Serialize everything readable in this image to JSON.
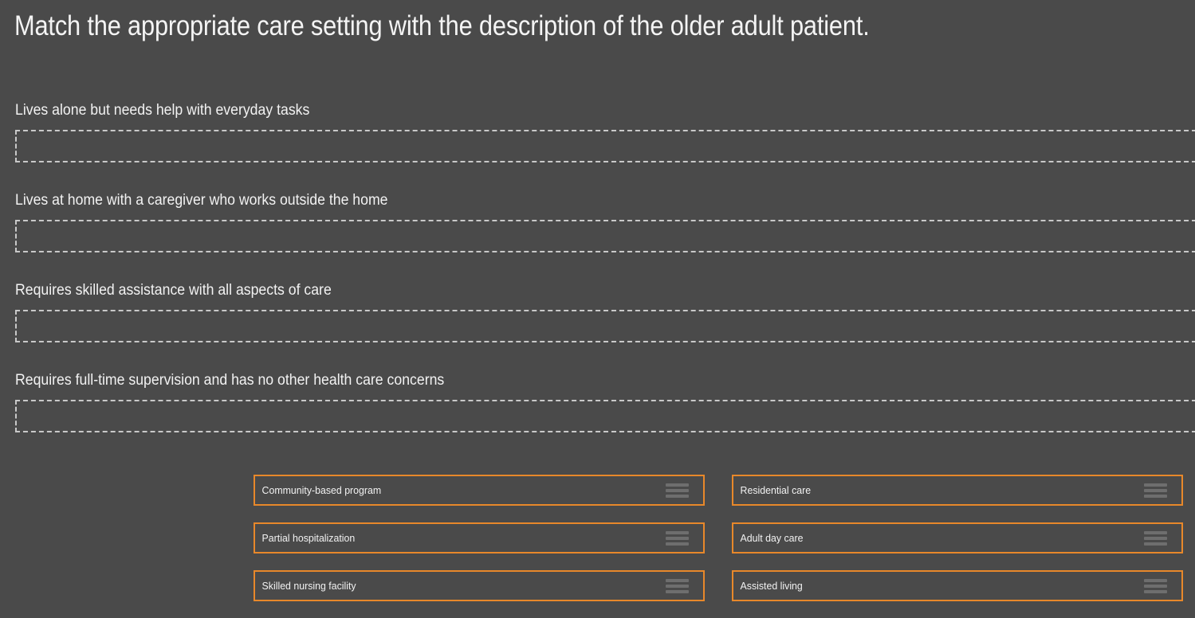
{
  "question": {
    "title": "Match the appropriate care setting with the description of the older adult patient."
  },
  "prompts": [
    {
      "label": "Lives alone but needs help with everyday tasks",
      "answer": ""
    },
    {
      "label": "Lives at home with a caregiver who works outside the home",
      "answer": ""
    },
    {
      "label": "Requires skilled assistance with all aspects of care",
      "answer": ""
    },
    {
      "label": "Requires full-time supervision and has no other health care concerns",
      "answer": ""
    }
  ],
  "options": {
    "rows": [
      {
        "left": "Community-based program",
        "right": "Residential care"
      },
      {
        "left": "Partial hospitalization",
        "right": "Adult day care"
      },
      {
        "left": "Skilled nursing facility",
        "right": "Assisted living"
      }
    ],
    "handle_icon": "drag-handle-icon"
  },
  "colors": {
    "background": "#4a4a4a",
    "accent": "#e8882a",
    "text": "#f2f2f2",
    "dropzone_border": "#c9c9c9",
    "handle": "#6e6e6e"
  }
}
